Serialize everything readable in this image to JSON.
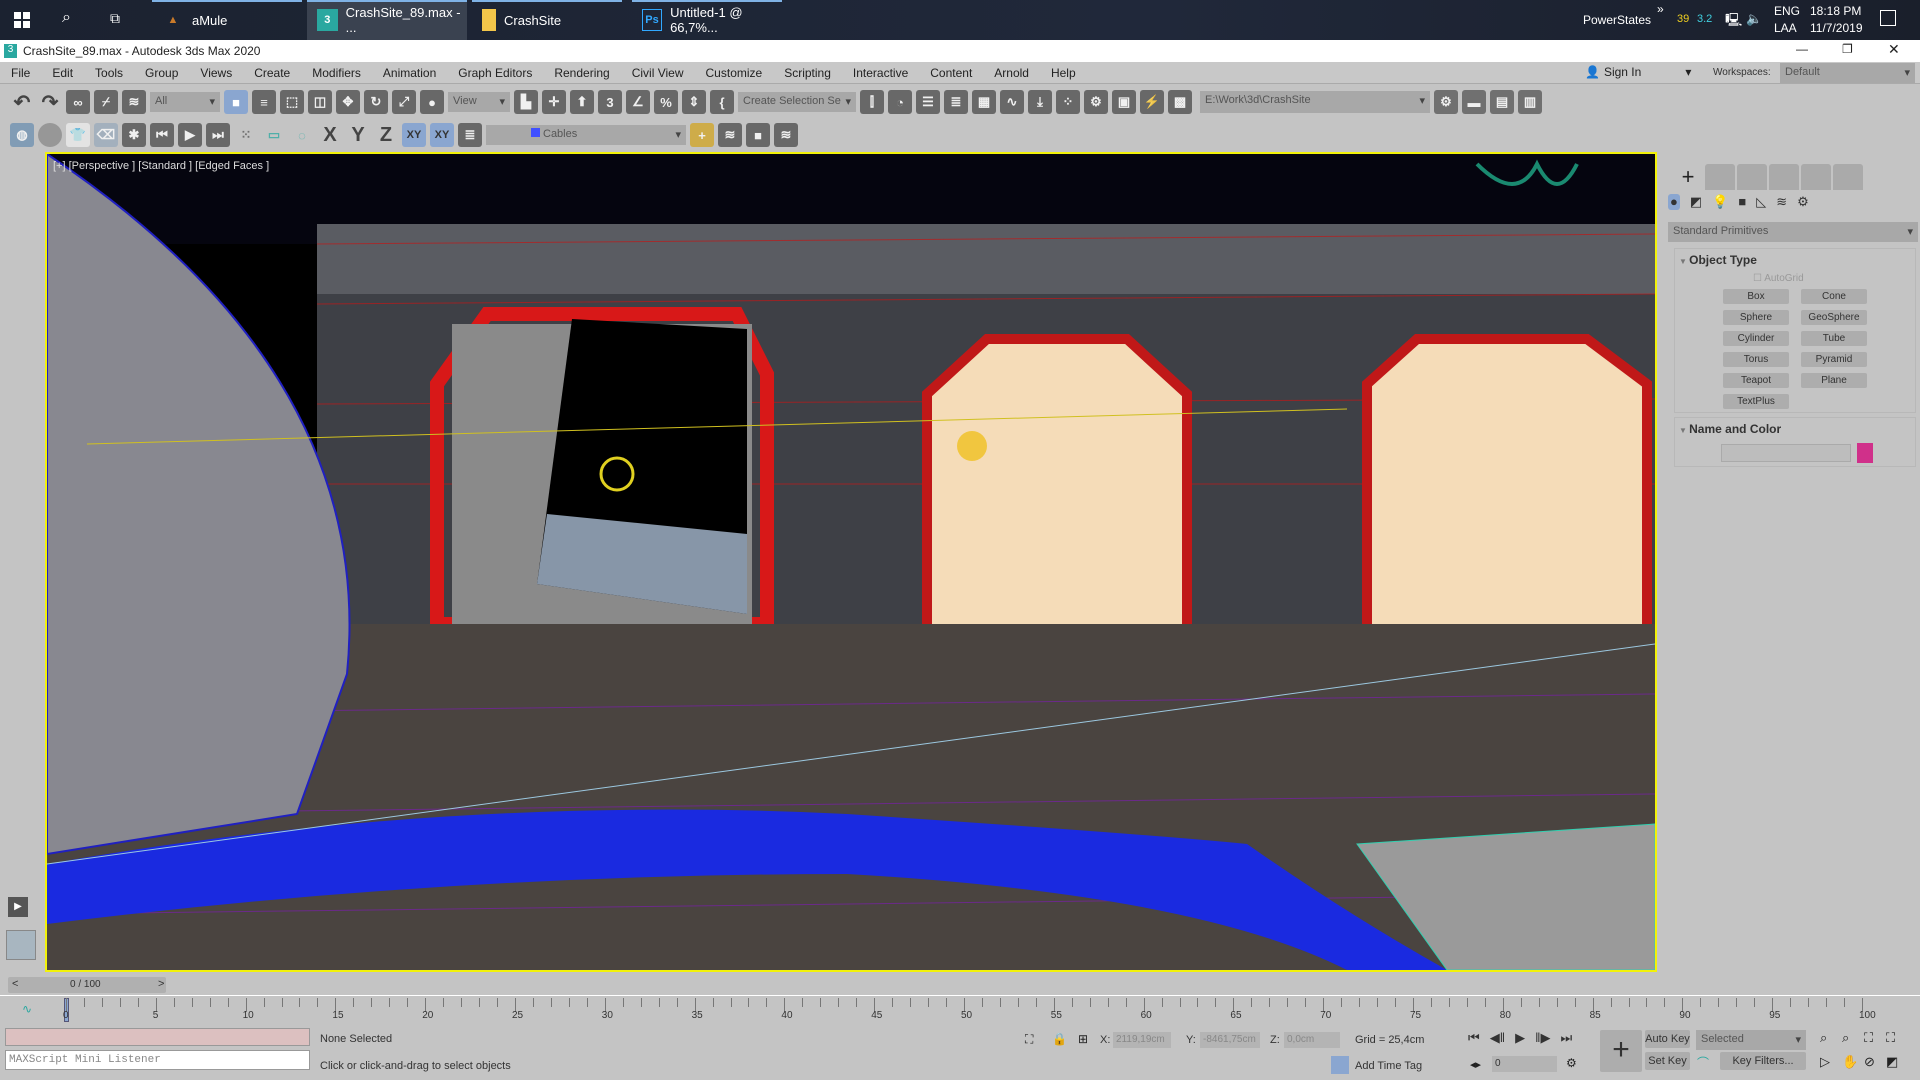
{
  "taskbar": {
    "apps": [
      {
        "label": "aMule",
        "icon": "amule-icon"
      },
      {
        "label": "CrashSite_89.max - ...",
        "icon": "3dsmax-icon",
        "active": true
      },
      {
        "label": "CrashSite",
        "icon": "folder-icon"
      },
      {
        "label": "Untitled-1 @ 66,7%...",
        "icon": "photoshop-icon"
      }
    ],
    "tray": {
      "powerstates": "PowerStates",
      "chevron": "»",
      "val1": "39",
      "val2": "3.2",
      "lang1": "ENG",
      "lang2": "LAA",
      "time": "18:18 PM",
      "date": "11/7/2019"
    }
  },
  "window": {
    "title": "CrashSite_89.max - Autodesk 3ds Max 2020"
  },
  "menu": [
    "File",
    "Edit",
    "Tools",
    "Group",
    "Views",
    "Create",
    "Modifiers",
    "Animation",
    "Graph Editors",
    "Rendering",
    "Civil View",
    "Customize",
    "Scripting",
    "Interactive",
    "Content",
    "Arnold",
    "Help"
  ],
  "account": {
    "sign_in": "Sign In",
    "workspaces_label": "Workspaces:",
    "workspace": "Default"
  },
  "toolbar": {
    "filter": "All",
    "ref_coord": "View",
    "selection_set": "Create Selection Se",
    "project_path": "E:\\Work\\3d\\CrashSite",
    "layer": "Cables",
    "axis": [
      "X",
      "Y",
      "Z",
      "XY",
      "XY"
    ]
  },
  "viewport": {
    "label": "[+] [Perspective ] [Standard ] [Edged Faces ]",
    "border_color": "#f2f20a"
  },
  "command_panel": {
    "category": "Standard Primitives",
    "object_type": "Object Type",
    "autogrid": "AutoGrid",
    "primitives": [
      "Box",
      "Cone",
      "Sphere",
      "GeoSphere",
      "Cylinder",
      "Tube",
      "Torus",
      "Pyramid",
      "Teapot",
      "Plane",
      "TextPlus"
    ],
    "name_and_color": "Name and Color",
    "object_color": "#d0308a"
  },
  "timeline": {
    "frame": "0 / 100",
    "ticks": [
      "0",
      "5",
      "10",
      "15",
      "20",
      "25",
      "30",
      "35",
      "40",
      "45",
      "50",
      "55",
      "60",
      "65",
      "70",
      "75",
      "80",
      "85",
      "90",
      "95",
      "100"
    ]
  },
  "status": {
    "listener": "MAXScript Mini Listener",
    "selection": "None Selected",
    "prompt": "Click or click-and-drag to select objects",
    "x_label": "X:",
    "x": "2119,19cm",
    "y_label": "Y:",
    "y": "-8461,75cm",
    "z_label": "Z:",
    "z": "0,0cm",
    "grid": "Grid = 25,4cm",
    "add_time_tag": "Add Time Tag",
    "current_frame": "0",
    "auto_key": "Auto Key",
    "set_key": "Set Key",
    "key_mode": "Selected",
    "key_filters": "Key Filters..."
  }
}
